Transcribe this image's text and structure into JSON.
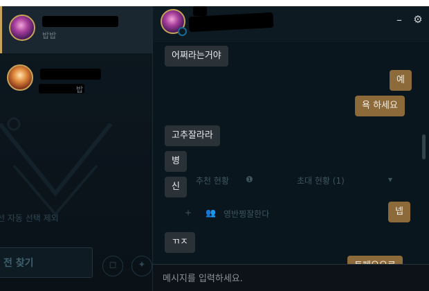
{
  "friends": [
    {
      "status": "밥밥",
      "avatar": "purple-avatar-icon"
    },
    {
      "status": "밥",
      "avatar": "orange-avatar-icon"
    }
  ],
  "background_labels": {
    "auto_pick": "선 자동 선택 제외",
    "find_match": "전 찾기",
    "recommend": "추천 현황",
    "invite": "초대 현황 (1)",
    "party": "영반찡잘한다"
  },
  "chat": {
    "messages": [
      {
        "dir": "in",
        "text": "어쩌라는거야"
      },
      {
        "dir": "out",
        "text": "예"
      },
      {
        "dir": "out",
        "text": "욕 하세요"
      },
      {
        "dir": "in",
        "text": "고추잘라라"
      },
      {
        "dir": "in",
        "text": "병"
      },
      {
        "dir": "in",
        "text": "신"
      },
      {
        "dir": "out",
        "text": "넵"
      },
      {
        "dir": "in",
        "text": "ㄲㅈ"
      },
      {
        "dir": "out",
        "text": "트페으으로"
      }
    ],
    "input_placeholder": "메시지를 입력하세요.",
    "header": {
      "minimize": "–",
      "settings": "⚙"
    }
  },
  "colors": {
    "accent": "#c8a35a",
    "out_bubble": "#8c6a3a",
    "in_bubble": "#2a3237"
  }
}
